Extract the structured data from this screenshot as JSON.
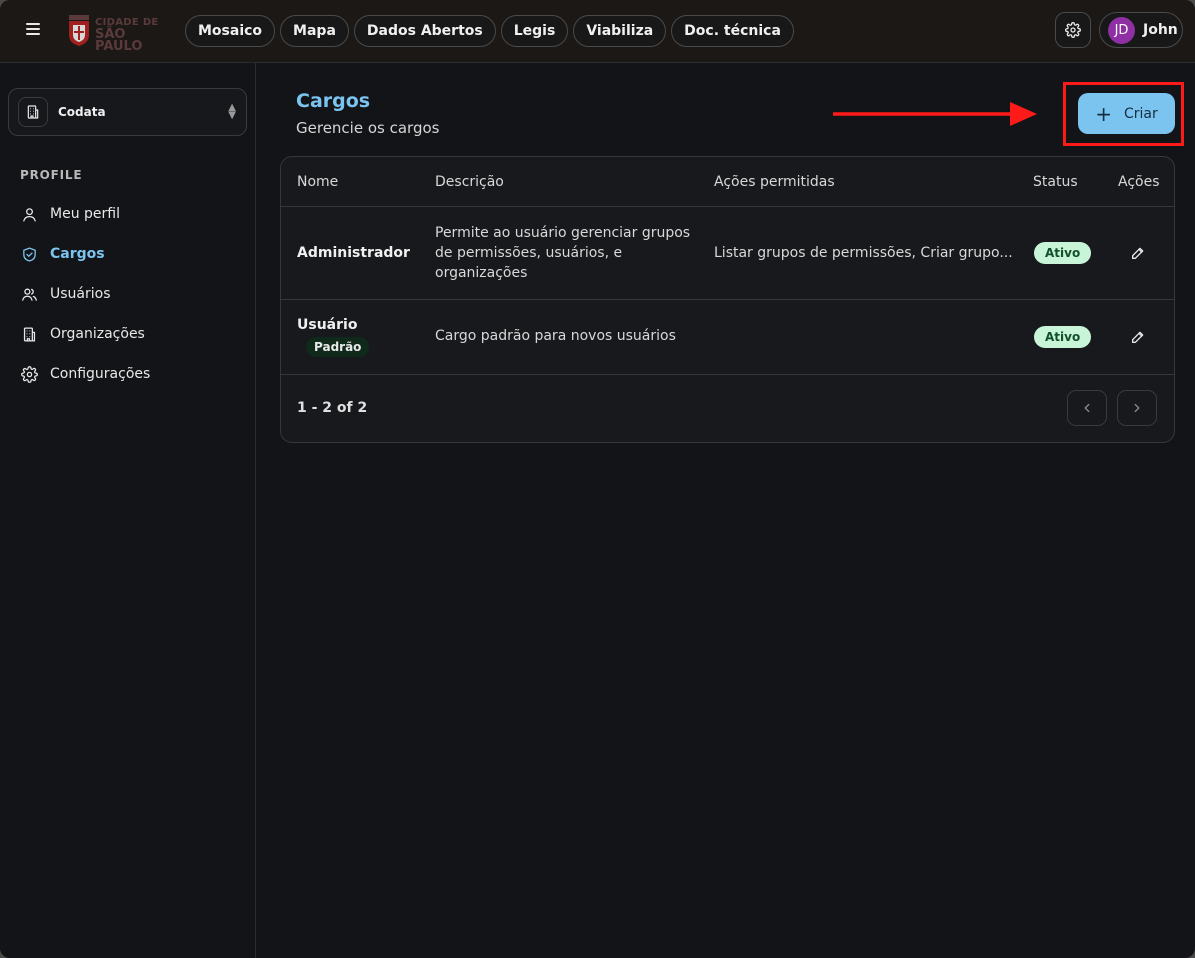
{
  "topbar": {
    "logo": {
      "line1": "CIDADE DE",
      "line2": "SÃO PAULO"
    },
    "chips": [
      "Mosaico",
      "Mapa",
      "Dados Abertos",
      "Legis",
      "Viabiliza",
      "Doc. técnica"
    ],
    "user": {
      "initials": "JD",
      "name": "John",
      "avatar_color": "#8e2fa3"
    }
  },
  "sidebar": {
    "organization": "Codata",
    "section_label": "PROFILE",
    "items": [
      {
        "label": "Meu perfil",
        "icon": "user-icon",
        "active": false
      },
      {
        "label": "Cargos",
        "icon": "shield-check-icon",
        "active": true
      },
      {
        "label": "Usuários",
        "icon": "users-icon",
        "active": false
      },
      {
        "label": "Organizações",
        "icon": "building-icon",
        "active": false
      },
      {
        "label": "Configurações",
        "icon": "gear-icon",
        "active": false
      }
    ]
  },
  "main": {
    "title": "Cargos",
    "subtitle": "Gerencie os cargos",
    "create_label": "Criar",
    "table": {
      "headers": {
        "name": "Nome",
        "description": "Descrição",
        "permissions": "Ações permitidas",
        "status": "Status",
        "actions": "Ações"
      },
      "rows": [
        {
          "name": "Administrador",
          "description": [
            "Permite ao usuário gerenciar grupos",
            "de permissões, usuários, e",
            "organizações"
          ],
          "permissions": "Listar grupos de permissões, Criar grupo...",
          "status": "Ativo"
        },
        {
          "name": "Usuário",
          "tag": "Padrão",
          "description": [
            "Cargo padrão para novos usuários"
          ],
          "permissions": "",
          "status": "Ativo"
        }
      ],
      "pagination": "1 - 2 of 2"
    }
  },
  "colors": {
    "accent": "#7cc4f0",
    "status_active_bg": "#c8f4d8",
    "status_active_text": "#12502a",
    "highlight": "#ff1a1a"
  }
}
